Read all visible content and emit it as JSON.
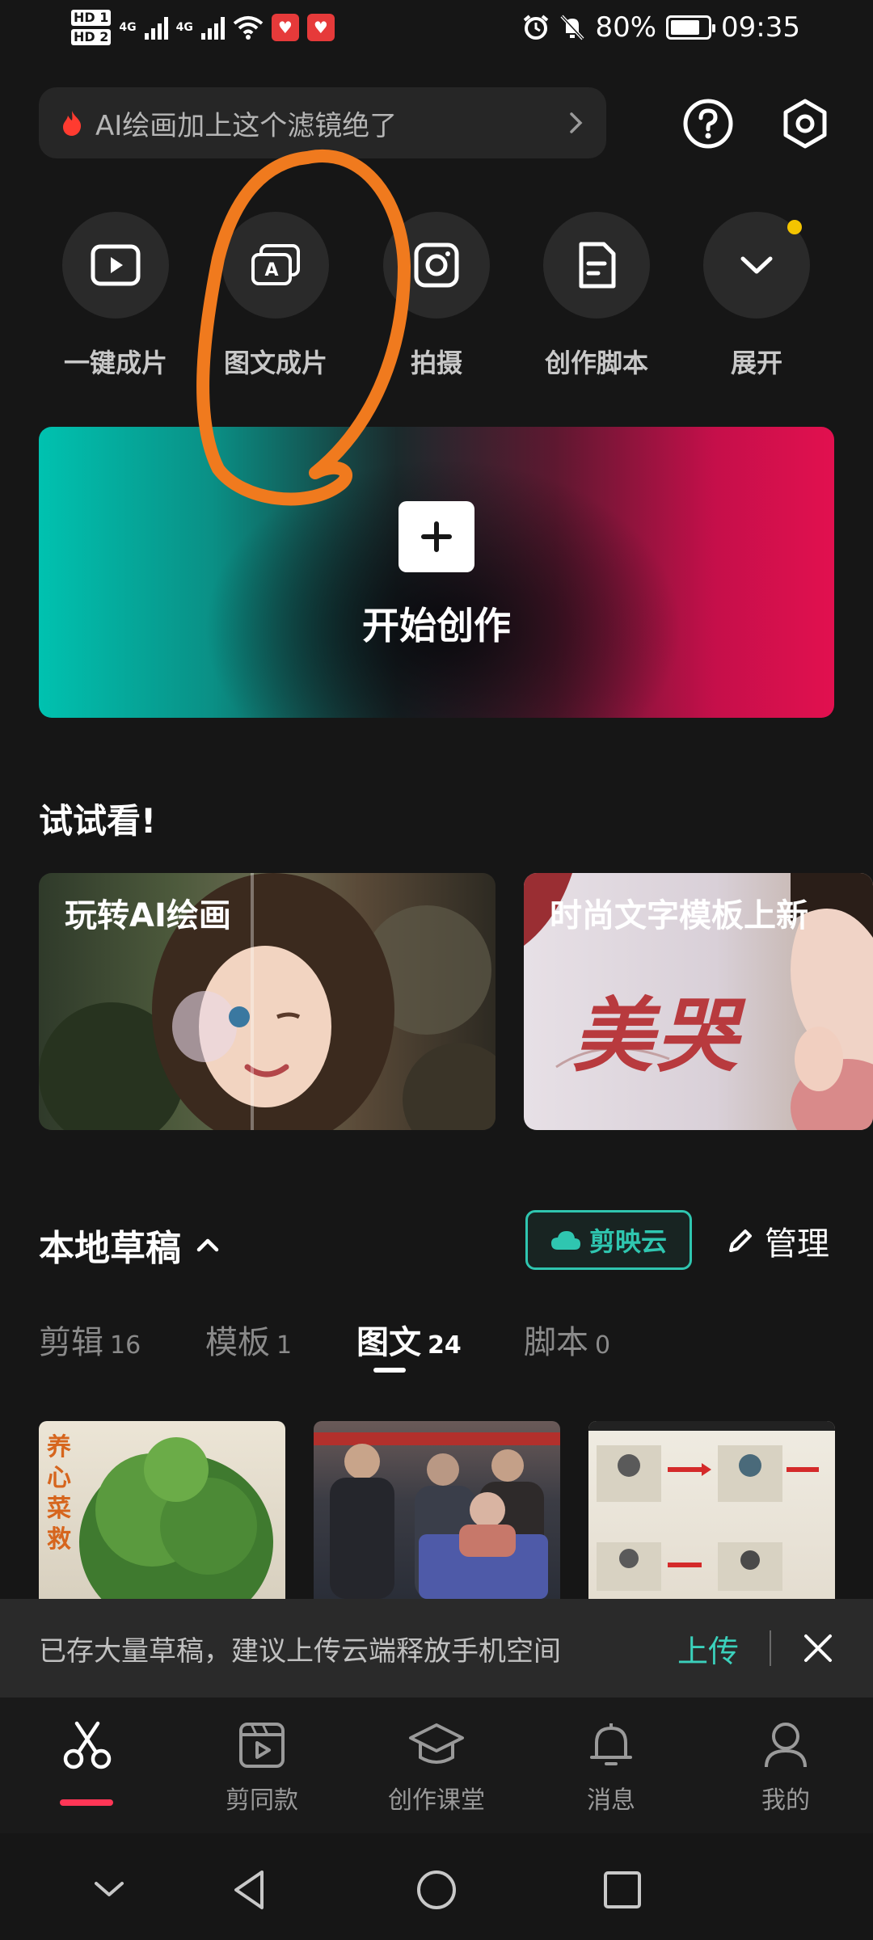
{
  "status_bar": {
    "sim1": "HD 1",
    "sim2": "HD 2",
    "network1": "4G",
    "network2": "4G",
    "battery_percent": "80%",
    "battery_level": 0.8,
    "time": "09:35",
    "icons": [
      "signal-icon",
      "wifi-icon",
      "app-badge-icon",
      "alarm-icon",
      "mute-icon",
      "battery-icon"
    ]
  },
  "header": {
    "search_text": "AI绘画加上这个滤镜绝了",
    "icons": [
      "flame-icon",
      "chevron-right-icon",
      "help-icon",
      "settings-icon"
    ]
  },
  "quick_actions": [
    {
      "label": "一键成片",
      "icon": "play-icon"
    },
    {
      "label": "图文成片",
      "icon": "text-image-icon"
    },
    {
      "label": "拍摄",
      "icon": "camera-icon"
    },
    {
      "label": "创作脚本",
      "icon": "script-icon"
    },
    {
      "label": "展开",
      "icon": "chevron-down-icon"
    }
  ],
  "banner": {
    "label": "开始创作",
    "icon": "plus-icon"
  },
  "try_section": {
    "title": "试试看!",
    "cards": [
      {
        "title": "玩转AI绘画"
      },
      {
        "title": "时尚文字模板上新",
        "overlay_text": "美哭"
      }
    ]
  },
  "drafts": {
    "title": "本地草稿",
    "cloud_label": "剪映云",
    "manage_label": "管理",
    "tabs": [
      {
        "label": "剪辑",
        "count": "16"
      },
      {
        "label": "模板",
        "count": "1"
      },
      {
        "label": "图文",
        "count": "24"
      },
      {
        "label": "脚本",
        "count": "0"
      }
    ],
    "active_tab": "图文",
    "thumbnails": [
      {
        "text": "养心菜救"
      },
      {
        "text": ""
      },
      {
        "text": ""
      }
    ]
  },
  "notice": {
    "text": "已存大量草稿，建议上传云端释放手机空间",
    "action": "上传"
  },
  "bottom_nav": [
    {
      "label": "",
      "icon": "scissors-icon",
      "active": true
    },
    {
      "label": "剪同款",
      "icon": "template-play-icon"
    },
    {
      "label": "创作课堂",
      "icon": "graduation-cap-icon"
    },
    {
      "label": "消息",
      "icon": "bell-icon"
    },
    {
      "label": "我的",
      "icon": "user-icon"
    }
  ],
  "system_nav": [
    "chevron-down-icon",
    "back-icon",
    "home-icon",
    "recents-icon"
  ],
  "colors": {
    "background": "#161616",
    "accent_teal": "#2fc6b0",
    "accent_red": "#ff3656",
    "annotation_orange": "#f07a1e"
  }
}
